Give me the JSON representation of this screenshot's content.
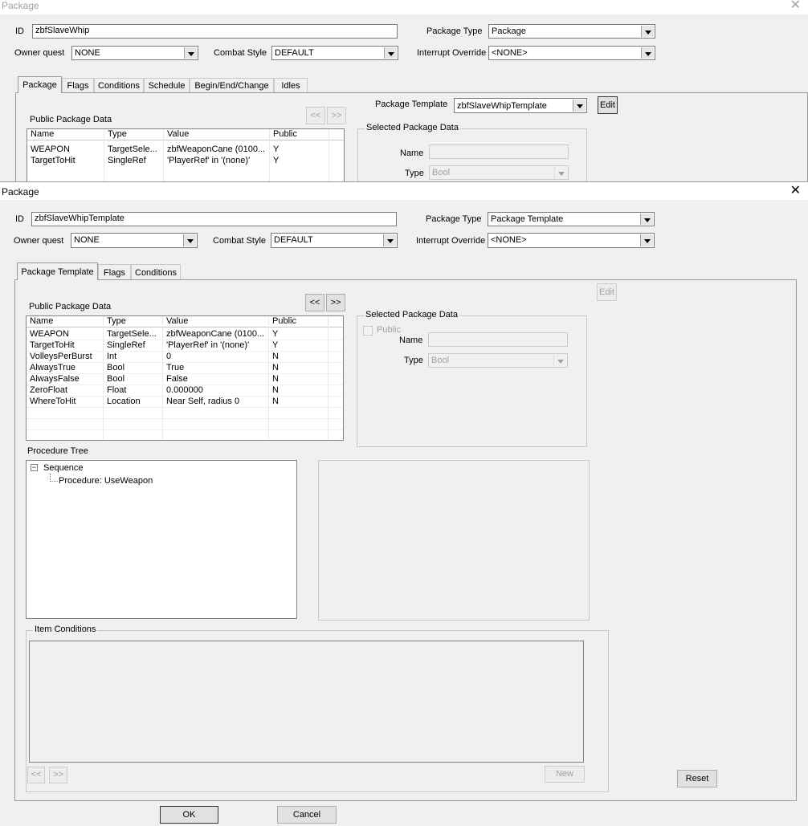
{
  "back_window": {
    "title": "Package",
    "close_glyph": "✕",
    "id_label": "ID",
    "id_value": "zbfSlaveWhip",
    "package_type_label": "Package Type",
    "package_type_value": "Package",
    "owner_quest_label": "Owner quest",
    "owner_quest_value": "NONE",
    "combat_style_label": "Combat Style",
    "combat_style_value": "DEFAULT",
    "interrupt_label": "Interrupt Override",
    "interrupt_value": "<NONE>",
    "tabs": [
      "Package",
      "Flags",
      "Conditions",
      "Schedule",
      "Begin/End/Change",
      "Idles"
    ],
    "template_label": "Package Template",
    "template_value": "zbfSlaveWhipTemplate",
    "edit_label": "Edit",
    "prev_label": "<<",
    "next_label": ">>",
    "ppd_label": "Public Package Data",
    "columns": [
      "Name",
      "Type",
      "Value",
      "Public"
    ],
    "rows": [
      [
        "WEAPON",
        "TargetSele...",
        "zbfWeaponCane (0100...",
        "Y"
      ],
      [
        "TargetToHit",
        "SingleRef",
        "'PlayerRef' in '(none)'",
        "Y"
      ]
    ],
    "selected_label": "Selected Package Data",
    "name_label": "Name",
    "type_label": "Type",
    "type_value": "Bool"
  },
  "front_window": {
    "title": "Package",
    "close_glyph": "✕",
    "id_label": "ID",
    "id_value": "zbfSlaveWhipTemplate",
    "package_type_label": "Package Type",
    "package_type_value": "Package Template",
    "owner_quest_label": "Owner quest",
    "owner_quest_value": "NONE",
    "combat_style_label": "Combat Style",
    "combat_style_value": "DEFAULT",
    "interrupt_label": "Interrupt Override",
    "interrupt_value": "<NONE>",
    "tabs": [
      "Package Template",
      "Flags",
      "Conditions"
    ],
    "edit_label": "Edit",
    "prev_label": "<<",
    "next_label": ">>",
    "ppd_label": "Public Package Data",
    "columns": [
      "Name",
      "Type",
      "Value",
      "Public"
    ],
    "rows": [
      [
        "WEAPON",
        "TargetSele...",
        "zbfWeaponCane (0100...",
        "Y"
      ],
      [
        "TargetToHit",
        "SingleRef",
        "'PlayerRef' in '(none)'",
        "Y"
      ],
      [
        "VolleysPerBurst",
        "Int",
        "0",
        "N"
      ],
      [
        "AlwaysTrue",
        "Bool",
        "True",
        "N"
      ],
      [
        "AlwaysFalse",
        "Bool",
        "False",
        "N"
      ],
      [
        "ZeroFloat",
        "Float",
        "0.000000",
        "N"
      ],
      [
        "WhereToHit",
        "Location",
        "Near Self, radius 0",
        "N"
      ]
    ],
    "selected_label": "Selected Package Data",
    "public_label": "Public",
    "name_label": "Name",
    "type_label": "Type",
    "type_value": "Bool",
    "procedure_tree_label": "Procedure Tree",
    "tree": {
      "expander": "−",
      "root": "Sequence",
      "child": "Procedure: UseWeapon"
    },
    "item_conditions_label": "Item Conditions",
    "new_label": "New",
    "reset_label": "Reset",
    "ok_label": "OK",
    "cancel_label": "Cancel"
  }
}
